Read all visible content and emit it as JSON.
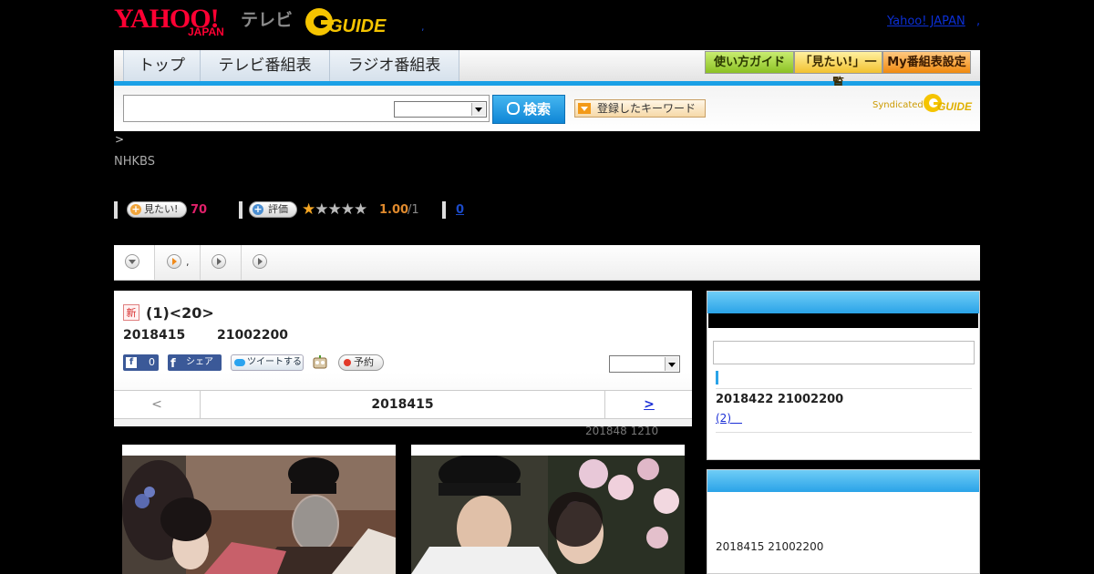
{
  "header": {
    "logo_yahoo": "YAHOO!",
    "logo_yahoo_sub": "JAPAN",
    "logo_tv": "テレビ",
    "logo_gguide": "GUIDE",
    "top_link": "Yahoo! JAPAN",
    "top_link_suffix": ",",
    "sep": ","
  },
  "nav": {
    "tabs": [
      "トップ",
      "テレビ番組表",
      "ラジオ番組表"
    ],
    "buttons": [
      {
        "label": "使い方ガイド",
        "color": "#9ed23b"
      },
      {
        "label": "「見たい!」一覧",
        "color": "#f7d04a"
      },
      {
        "label": "My番組表設定",
        "color": "#f39a18"
      }
    ]
  },
  "search": {
    "input_value": "",
    "button_label": "検索",
    "keyword_button": "登録したキーワード",
    "syndicated": "Syndicated",
    "syndicated_logo": "GUIDE"
  },
  "breadcrumb": ">",
  "channel": "NHKBS",
  "stats": {
    "want_label": "見たい!",
    "want_count": "70",
    "rate_label": "評価",
    "rating": "1.00",
    "rating_den": "/1",
    "stars_filled": 1,
    "stars_total": 5,
    "review_count": "0"
  },
  "subtabs": [
    {
      "label": ""
    },
    {
      "label": ","
    },
    {
      "label": ""
    },
    {
      "label": ""
    }
  ],
  "program": {
    "new_badge": "新",
    "title": "(1)<20>",
    "date": "2018415",
    "time": "21002200",
    "fb_like_count": "0",
    "fb_share": "シェア",
    "tweet": "ツイートする",
    "reserve": "予約",
    "pager_prev": "<",
    "pager_date": "2018415",
    "pager_next": ">",
    "updated": "201848  1210"
  },
  "sidebar": {
    "next_airtime": "2018422  21002200",
    "next_link": "(2)　",
    "second_airtime": "2018415  21002200"
  },
  "colors": {
    "accent_blue": "#1aa0e6",
    "yahoo_red": "#ff0033",
    "want_pink": "#e0206a",
    "rating_orange": "#e08a2d",
    "link_blue": "#1b2fd6"
  }
}
